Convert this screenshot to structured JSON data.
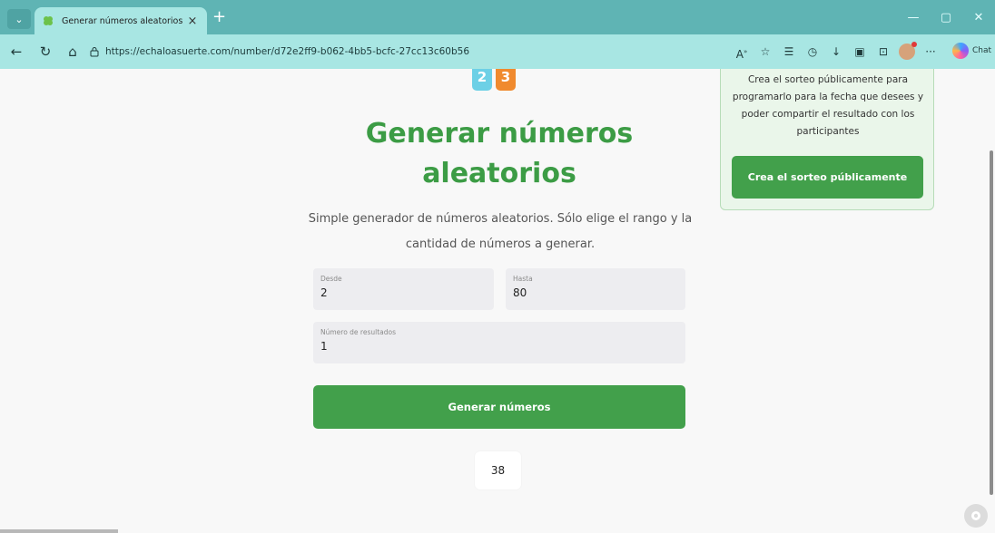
{
  "browser": {
    "tab_list_icon": "chevron-down-icon",
    "tab_title": "Generar números aleatorios",
    "tab_close": "×",
    "new_tab": "+",
    "window": {
      "minimize": "—",
      "maximize": "▢",
      "close": "✕"
    },
    "url": "https://echaloasuerte.com/number/d72e2ff9-b062-4bb5-bcfc-27cc13c60b56",
    "chat_label": "Chat"
  },
  "logo": {
    "tile_a": "2",
    "tile_b": "3"
  },
  "main": {
    "title": "Generar números aleatorios",
    "subtitle": "Simple generador de números aleatorios. Sólo elige el rango y la cantidad de números a generar.",
    "fields": {
      "desde": {
        "label": "Desde",
        "value": "2"
      },
      "hasta": {
        "label": "Hasta",
        "value": "80"
      },
      "num_resultados": {
        "label": "Número de resultados",
        "value": "1"
      }
    },
    "generate_button": "Generar números",
    "result": "38"
  },
  "side_card": {
    "text": "Crea el sorteo públicamente para programarlo para la fecha que desees y poder compartir el resultado con los participantes",
    "button": "Crea el sorteo públicamente"
  },
  "colors": {
    "brand_green": "#3c9c45",
    "button_green": "#42a04b",
    "chrome_teal": "#5fb4b4",
    "addressbar": "#a8e6e3"
  }
}
